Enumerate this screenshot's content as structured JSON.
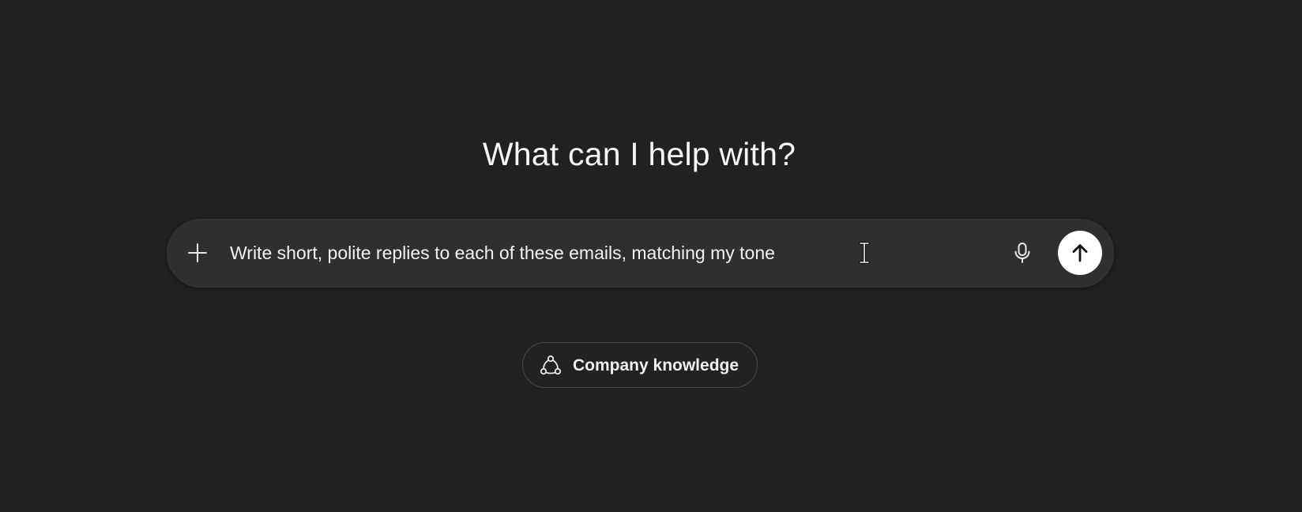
{
  "main": {
    "headline": "What can I help with?"
  },
  "composer": {
    "input_value": "Write short, polite replies to each of these emails, matching my tone",
    "icons": {
      "add": "plus-icon",
      "voice": "microphone-icon",
      "send": "arrow-up-icon"
    }
  },
  "chips": {
    "company_knowledge": {
      "label": "Company knowledge",
      "icon": "connected-nodes-icon"
    }
  },
  "colors": {
    "background": "#1f2220",
    "composer_background": "#2f302e",
    "send_button": "#ffffff",
    "text": "#ffffff"
  }
}
